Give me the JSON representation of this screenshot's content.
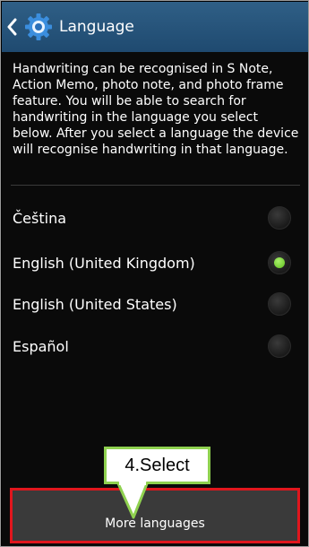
{
  "header": {
    "title": "Language"
  },
  "description": "Handwriting can be recognised in S Note, Action Memo, photo note, and photo frame feature. You will be able to search for handwriting in the language you select below. After you select a language the device will recognise handwriting in that language.",
  "languages": [
    {
      "label": "Čeština",
      "selected": false
    },
    {
      "label": "English (United Kingdom)",
      "selected": true
    },
    {
      "label": "English (United States)",
      "selected": false
    },
    {
      "label": "Español",
      "selected": false
    }
  ],
  "more_button": {
    "label": "More languages"
  },
  "annotation": {
    "text": "4.Select"
  },
  "colors": {
    "action_bar": "#2a5a82",
    "radio_selected": "#7fd93a",
    "highlight_box": "#e0161d",
    "callout_border": "#8fd14f"
  },
  "icons": {
    "back": "chevron-left-icon",
    "settings": "gear-icon"
  }
}
